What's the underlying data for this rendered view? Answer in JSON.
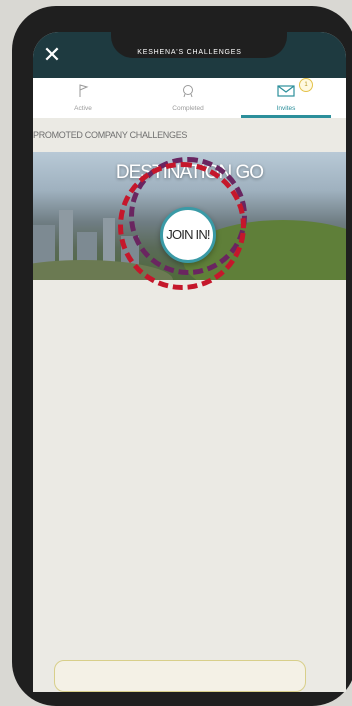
{
  "header": {
    "title": "KESHENA'S CHALLENGES",
    "close_icon": "close-icon"
  },
  "tabs": [
    {
      "label": "Active",
      "icon": "flag-icon",
      "active": false
    },
    {
      "label": "Completed",
      "icon": "medal-icon",
      "active": false
    },
    {
      "label": "Invites",
      "icon": "envelope-icon",
      "active": true,
      "badge": "1"
    }
  ],
  "section": {
    "label": "PROMOTED COMPANY CHALLENGES"
  },
  "banner": {
    "title": "DESTINATION GO",
    "join_label": "JOIN IN!"
  },
  "colors": {
    "header_bg": "#1e3a40",
    "accent": "#2c8f9b",
    "highlight_purple": "#6a2560",
    "highlight_red": "#c5172b"
  }
}
